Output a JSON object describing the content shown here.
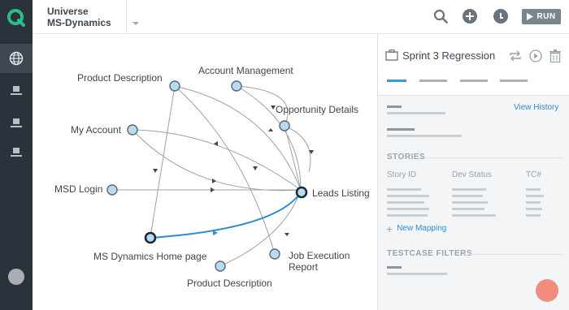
{
  "header": {
    "universe_line1": "Universe",
    "universe_line2": "MS-Dynamics",
    "run_label": "RUN",
    "icons": [
      "search-icon",
      "add-icon",
      "user-icon"
    ]
  },
  "sidebar": {
    "items": [
      "globe-icon",
      "monitor-icon",
      "monitor-icon",
      "monitor-icon"
    ]
  },
  "graph": {
    "nodes": [
      {
        "id": "product-description-top",
        "label": "Product Description"
      },
      {
        "id": "account-management",
        "label": "Account Management"
      },
      {
        "id": "opportunity-details",
        "label": "Opportunity Details"
      },
      {
        "id": "my-account",
        "label": "My Account"
      },
      {
        "id": "msd-login",
        "label": "MSD Login"
      },
      {
        "id": "leads-listing",
        "label": "Leads Listing"
      },
      {
        "id": "ms-dynamics-home",
        "label": "MS Dynamics Home page"
      },
      {
        "id": "job-execution-report",
        "label": "Job Execution Report",
        "label_line1": "Job Execution",
        "label_line2": "Report"
      },
      {
        "id": "product-description-bottom",
        "label": "Product Description"
      }
    ],
    "colors": {
      "node_fill": "#b6dbf3",
      "node_stroke": "#5a6670",
      "edge": "#9aa1a8",
      "highlight": "#2a8ad4"
    }
  },
  "panel": {
    "title": "Sprint 3 Regression",
    "view_history": "View History",
    "stories_title": "STORIES",
    "columns": [
      "Story ID",
      "Dev Status",
      "TC#"
    ],
    "new_mapping": "New Mapping",
    "testcase_filters_title": "TESTCASE FILTERS",
    "icons": [
      "briefcase-icon",
      "repeat-icon",
      "play-icon",
      "trash-icon"
    ],
    "fab_color": "#f18c7e"
  }
}
